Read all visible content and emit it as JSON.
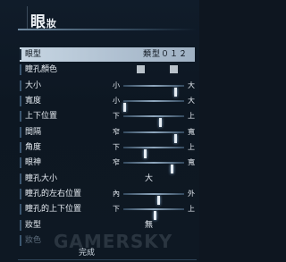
{
  "header": {
    "title_main": "眼",
    "title_sub": "妝"
  },
  "menu": {
    "eye_type": {
      "label": "眼型",
      "value": "類型０１２"
    },
    "pupil_color": {
      "label": "瞳孔顏色",
      "swatch_colors": [
        "#b9c2ca",
        "#b9c2ca"
      ]
    },
    "size": {
      "label": "大小",
      "left": "小",
      "right": "大",
      "level": 0.86
    },
    "width": {
      "label": "寬度",
      "left": "小",
      "right": "大",
      "level": 0.02
    },
    "vertical_position": {
      "label": "上下位置",
      "left": "下",
      "right": "上",
      "level": 0.6
    },
    "spacing": {
      "label": "間隔",
      "left": "窄",
      "right": "寬",
      "level": 0.86
    },
    "angle": {
      "label": "角度",
      "left": "下",
      "right": "上",
      "level": 0.36
    },
    "expression": {
      "label": "眼神",
      "left": "窄",
      "right": "寬",
      "level": 0.8
    },
    "pupil_size": {
      "label": "瞳孔大小",
      "value": "大"
    },
    "pupil_horizontal": {
      "label": "瞳孔的左右位置",
      "left": "內",
      "right": "外",
      "level": 0.57
    },
    "pupil_vertical": {
      "label": "瞳孔的上下位置",
      "left": "下",
      "right": "上",
      "level": 0.51
    },
    "makeup_type": {
      "label": "妝型",
      "value": "無"
    },
    "makeup_color": {
      "label": "妝色"
    }
  },
  "footer": {
    "complete_label": "完成",
    "watermark": "GAMERSKY"
  },
  "colors": {
    "selected_row": "#c7d6e3",
    "background": "#0e1620",
    "accent": "#3b5670"
  }
}
